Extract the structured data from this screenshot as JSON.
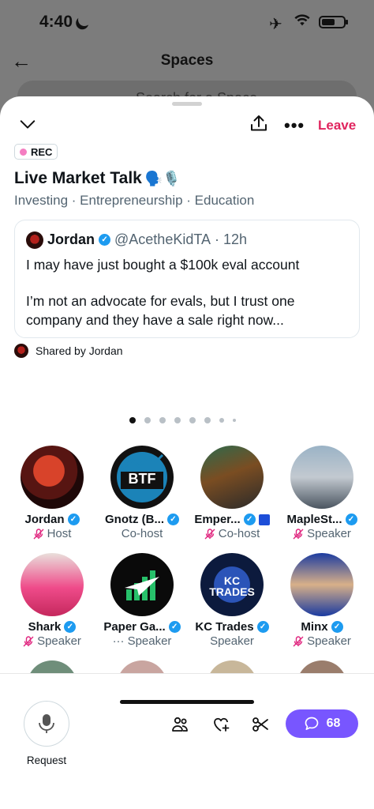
{
  "status_bar": {
    "time": "4:40"
  },
  "background": {
    "title": "Spaces",
    "search_placeholder": "Search for a Space"
  },
  "space": {
    "leave_label": "Leave",
    "rec_label": "REC",
    "title": "Live Market Talk",
    "title_emojis": "🗣️🎙️",
    "topics": "Investing · Entrepreneurship · Education",
    "tweet": {
      "name": "Jordan",
      "handle": "@AcetheKidTA",
      "time": "· 12h",
      "line1": "I may have just bought a $100k eval account",
      "line2": "I’m not an advocate for evals, but I trust one company and they have a sale right now..."
    },
    "shared_by": "Shared by Jordan",
    "pager": {
      "count": 8,
      "active": 0
    }
  },
  "participants": [
    {
      "name": "Jordan",
      "role": "Host",
      "verified": true,
      "muted": true
    },
    {
      "name": "Gnotz (B...",
      "role": "Co-host",
      "verified": true,
      "muted": false
    },
    {
      "name": "Emper...",
      "role": "Co-host",
      "verified": true,
      "muted": true
    },
    {
      "name": "MapleSt...",
      "role": "Speaker",
      "verified": true,
      "muted": true
    },
    {
      "name": "Shark",
      "role": "Speaker",
      "verified": true,
      "muted": true
    },
    {
      "name": "Paper Ga...",
      "role": "Speaker",
      "verified": true,
      "muted": false,
      "prefix": "···"
    },
    {
      "name": "KC Trades",
      "role": "Speaker",
      "verified": true,
      "muted": false
    },
    {
      "name": "Minx",
      "role": "Speaker",
      "verified": true,
      "muted": true
    }
  ],
  "avatar_labels": {
    "gnotz": "BTF",
    "kc": "KC TRADES"
  },
  "bottom_bar": {
    "request_label": "Request",
    "chat_count": "68"
  },
  "colors": {
    "accent": "#7856ff",
    "leave": "#e0245e",
    "verified": "#1d9bf0",
    "mic_off": "#e0247e"
  }
}
